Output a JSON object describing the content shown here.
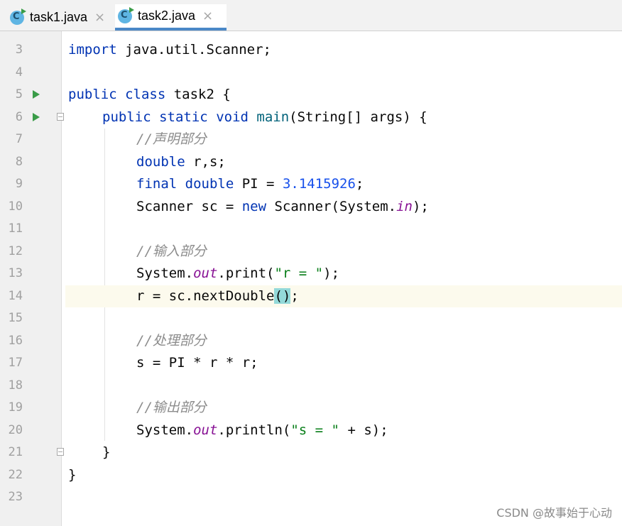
{
  "tabs": [
    {
      "label": "task1.java",
      "close": "×",
      "active": false
    },
    {
      "label": "task2.java",
      "close": "×",
      "active": true
    }
  ],
  "lines": [
    {
      "n": "3"
    },
    {
      "n": "4"
    },
    {
      "n": "5"
    },
    {
      "n": "6"
    },
    {
      "n": "7"
    },
    {
      "n": "8"
    },
    {
      "n": "9"
    },
    {
      "n": "10"
    },
    {
      "n": "11"
    },
    {
      "n": "12"
    },
    {
      "n": "13"
    },
    {
      "n": "14"
    },
    {
      "n": "15"
    },
    {
      "n": "16"
    },
    {
      "n": "17"
    },
    {
      "n": "18"
    },
    {
      "n": "19"
    },
    {
      "n": "20"
    },
    {
      "n": "21"
    },
    {
      "n": "22"
    },
    {
      "n": "23"
    }
  ],
  "code": {
    "l3": {
      "kw": "import",
      "rest": " java.util.Scanner;"
    },
    "l5": {
      "kw1": "public",
      "kw2": "class",
      "rest": " task2 {"
    },
    "l6": {
      "kw1": "public",
      "kw2": "static",
      "kw3": "void",
      "fn": "main",
      "rest": "(String[] args) {"
    },
    "l7": {
      "comment": "//声明部分"
    },
    "l8": {
      "kw": "double",
      "rest": " r,s;"
    },
    "l9": {
      "kw1": "final",
      "kw2": "double",
      "rest": " PI = ",
      "num": "3.1415926",
      "end": ";"
    },
    "l10": {
      "pre": "Scanner sc = ",
      "kw": "new",
      "mid": " Scanner(System.",
      "static": "in",
      "end": ");"
    },
    "l12": {
      "comment": "//输入部分"
    },
    "l13": {
      "pre": "System.",
      "static": "out",
      "mid": ".print(",
      "str": "\"r = \"",
      "end": ");"
    },
    "l14": {
      "pre": "r = sc.nextDouble",
      "hl": "()",
      "end": ";"
    },
    "l16": {
      "comment": "//处理部分"
    },
    "l17": {
      "text": "s = PI * r * r;"
    },
    "l19": {
      "comment": "//输出部分"
    },
    "l20": {
      "pre": "System.",
      "static": "out",
      "mid": ".println(",
      "str": "\"s = \"",
      "end": " + s);"
    },
    "l21": {
      "text": "}"
    },
    "l22": {
      "text": "}"
    }
  },
  "watermark": "CSDN @故事始于心动"
}
